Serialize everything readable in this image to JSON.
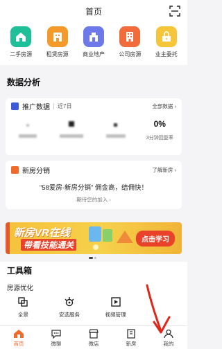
{
  "header": {
    "title": "首页",
    "scan_icon": "scan-icon"
  },
  "quick_actions": [
    {
      "label": "二手房源",
      "color": "#1fbf9a",
      "icon": "house-icon"
    },
    {
      "label": "租赁房源",
      "color": "#f39a2a",
      "icon": "building-icon"
    },
    {
      "label": "商业地产",
      "color": "#6d79e8",
      "icon": "shop-icon"
    },
    {
      "label": "公司房源",
      "color": "#f26b3a",
      "icon": "company-icon"
    },
    {
      "label": "业主委托",
      "color": "#f5c53a",
      "icon": "lock-icon"
    }
  ],
  "data_analysis": {
    "title": "数据分析",
    "promo_card": {
      "title": "推广数据",
      "period": "近7日",
      "more_label": "全部数据",
      "accent": "#3d5bd9",
      "stats": [
        {
          "value": "",
          "label": ""
        },
        {
          "value": "",
          "label": ""
        },
        {
          "value": "",
          "label": ""
        },
        {
          "value": "0%",
          "label": "3分钟回复率"
        }
      ]
    },
    "newhome_card": {
      "title": "新房分销",
      "more_label": "了解新房",
      "accent": "#f06a2a",
      "headline": "\"58爱房-新房分销\" 佣金高，结佣快！",
      "cta": "期待您的加入"
    }
  },
  "banner": {
    "line1": "新房VR在线",
    "line2": "带看技能通关",
    "button": "点击学习",
    "colors": {
      "bg": "#f5c13c",
      "text": "#ffffff",
      "button_bg": "#e8422b"
    }
  },
  "toolbox": {
    "title": "工具箱",
    "subtitle": "房源优化",
    "items": [
      {
        "label": "全景",
        "icon": "panorama-icon"
      },
      {
        "label": "安选服务",
        "icon": "service-icon"
      },
      {
        "label": "视频管理",
        "icon": "video-icon"
      }
    ]
  },
  "tabbar": [
    {
      "label": "首页",
      "icon": "home-tab-icon",
      "active": true
    },
    {
      "label": "微聊",
      "icon": "chat-tab-icon",
      "active": false
    },
    {
      "label": "微店",
      "icon": "store-tab-icon",
      "active": false
    },
    {
      "label": "新房",
      "icon": "newhome-tab-icon",
      "active": false
    },
    {
      "label": "我的",
      "icon": "profile-tab-icon",
      "active": false
    }
  ]
}
